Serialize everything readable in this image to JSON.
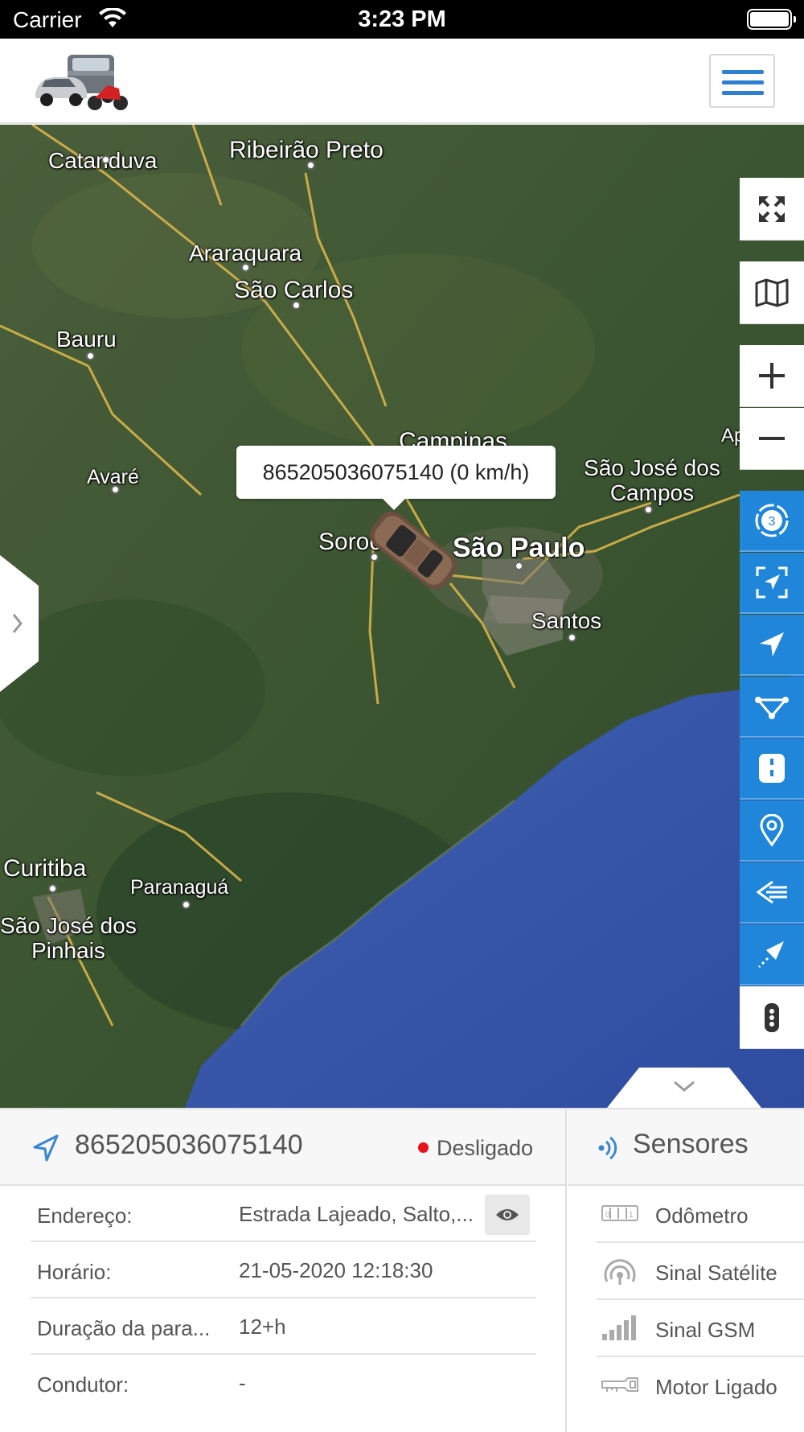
{
  "status_bar": {
    "carrier": "Carrier",
    "time": "3:23 PM"
  },
  "header": {
    "logo": "vehicles-logo",
    "menu_icon": "hamburger-menu-icon"
  },
  "map": {
    "popup": "865205036075140 (0 km/h)",
    "cities": [
      {
        "name": "Catanduva",
        "id": "catanduva"
      },
      {
        "name": "Ribeirão Preto",
        "id": "ribeirao-preto"
      },
      {
        "name": "Araraquara",
        "id": "araraquara"
      },
      {
        "name": "São Carlos",
        "id": "sao-carlos"
      },
      {
        "name": "Bauru",
        "id": "bauru"
      },
      {
        "name": "Campinas",
        "id": "campinas"
      },
      {
        "name": "Aparecida",
        "id": "aparecida"
      },
      {
        "name": "São José dos Campos",
        "id": "sao-jose-dos-campos"
      },
      {
        "name": "Avaré",
        "id": "avare"
      },
      {
        "name": "Sorocaba",
        "id": "sorocaba"
      },
      {
        "name": "São Paulo",
        "id": "sao-paulo"
      },
      {
        "name": "Santos",
        "id": "santos"
      },
      {
        "name": "Curitiba",
        "id": "curitiba"
      },
      {
        "name": "Paranaguá",
        "id": "paranagua"
      },
      {
        "name": "São José dos Pinhais",
        "id": "sao-jose-dos-pinhais"
      }
    ],
    "badge_count": "3",
    "controls": [
      "fullscreen-icon",
      "map-layers-icon",
      "zoom-in-icon",
      "zoom-out-icon",
      "clusters-icon",
      "fit-bounds-icon",
      "navigation-icon",
      "route-icon",
      "road-icon",
      "poi-marker-icon",
      "history-icon",
      "send-command-icon",
      "more-icon"
    ]
  },
  "device": {
    "id": "865205036075140",
    "status": "Desligado",
    "status_color": "#e8121b",
    "details": [
      {
        "label": "Endereço:",
        "value": "Estrada Lajeado, Salto,..."
      },
      {
        "label": "Horário:",
        "value": "21-05-2020 12:18:30"
      },
      {
        "label": "Duração da para...",
        "value": "12+h"
      },
      {
        "label": "Condutor:",
        "value": "-"
      }
    ]
  },
  "sensors": {
    "title": "Sensores",
    "items": [
      {
        "label": "Odômetro",
        "icon": "odometer-icon"
      },
      {
        "label": "Sinal Satélite",
        "icon": "satellite-signal-icon"
      },
      {
        "label": "Sinal GSM",
        "icon": "gsm-signal-icon"
      },
      {
        "label": "Motor Ligado",
        "icon": "engine-key-icon"
      }
    ]
  },
  "colors": {
    "accent": "#1f86d9",
    "menu": "#2f7fd0"
  }
}
